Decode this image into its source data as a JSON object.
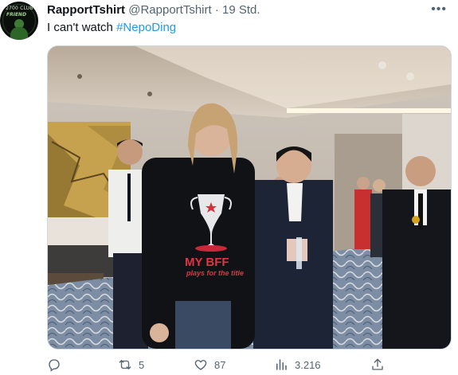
{
  "user": {
    "name": "RapportTshirt",
    "handle": "@RapportTshirt",
    "separator": "·",
    "time": "19 Std.",
    "avatar_text_top": "2700 CLUB",
    "avatar_text_bottom": "FRIEND"
  },
  "tweet": {
    "text": "I can't watch ",
    "hashtag": "#NepoDing"
  },
  "media": {
    "shirt_line1": "MY BFF",
    "shirt_line2": "plays for the title"
  },
  "actions": {
    "more_icon": "ellipsis-icon",
    "reply_icon": "reply-icon",
    "retweet_icon": "retweet-icon",
    "retweet_count": "5",
    "like_icon": "heart-icon",
    "like_count": "87",
    "views_icon": "bar-chart-icon",
    "views_count": "3.216",
    "share_icon": "share-icon"
  },
  "colors": {
    "text": "#0f1419",
    "secondary": "#536471",
    "link": "#1d9bf0",
    "border": "#cfd9de"
  }
}
